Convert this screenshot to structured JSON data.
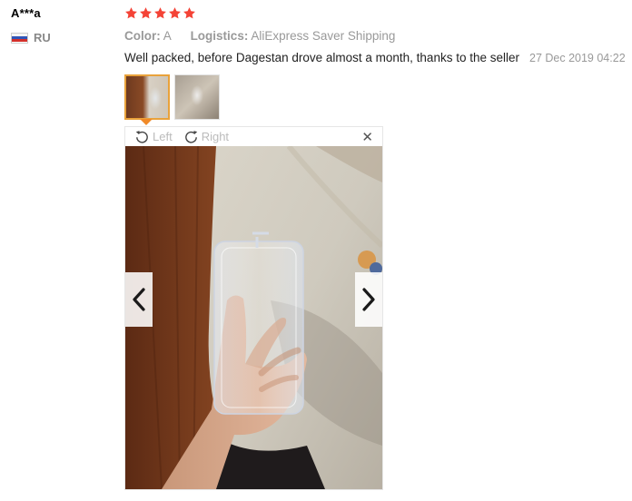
{
  "user": {
    "name": "A***a",
    "country": "RU",
    "flag_icon": "russia-flag-icon"
  },
  "rating": {
    "stars": 5,
    "max": 5,
    "color": "#f44336"
  },
  "review": {
    "color_label": "Color:",
    "color_value": "A",
    "logistics_label": "Logistics:",
    "logistics_value": "AliExpress Saver Shipping",
    "text": "Well packed, before Dagestan drove almost a month, thanks to the seller",
    "date": "27 Dec 2019 04:22"
  },
  "thumbnails": [
    {
      "selected": true,
      "accent": "#e9a23b"
    },
    {
      "selected": false
    }
  ],
  "viewer": {
    "rotate_left_label": "Left",
    "rotate_right_label": "Right",
    "close_icon": "close-icon",
    "prev_icon": "chevron-left-icon",
    "next_icon": "chevron-right-icon"
  }
}
